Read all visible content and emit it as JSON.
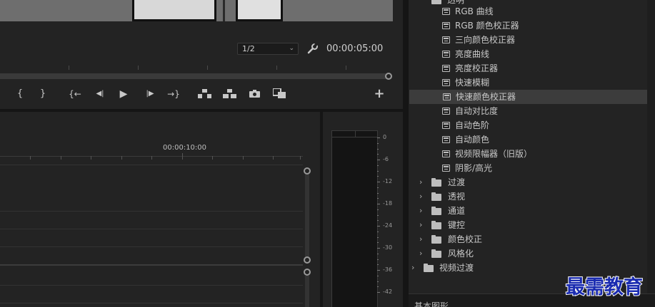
{
  "monitor": {
    "resolution": "1/2",
    "resolution_arrow": "⌄",
    "timecode": "00:00:05:00",
    "transport": {
      "mark_in": "{",
      "mark_out": "}",
      "go_in": "{←",
      "step_back": "◀|",
      "play": "▶",
      "step_forward": "|▶",
      "go_out": "→}",
      "lift": "⏏",
      "extract": "⏏",
      "export_frame": "📷",
      "compare": "⧉",
      "add": "+"
    }
  },
  "timeline": {
    "timecode": "00:00:10:00"
  },
  "meter": {
    "scale": [
      "0",
      "-6",
      "-12",
      "-18",
      "-24",
      "-30",
      "-36",
      "-42"
    ]
  },
  "effects": {
    "parent_folder": "透明",
    "items": [
      "RGB 曲线",
      "RGB 颜色校正器",
      "三向颜色校正器",
      "亮度曲线",
      "亮度校正器",
      "快速模糊",
      "快速颜色校正器",
      "自动对比度",
      "自动色阶",
      "自动颜色",
      "视频限幅器（旧版）",
      "阴影/高光"
    ],
    "selected_index": 6,
    "folders": [
      "过渡",
      "透视",
      "通道",
      "键控",
      "颜色校正",
      "风格化"
    ],
    "top_folder": "视频过渡",
    "bottom_panel": "基本图形"
  },
  "watermark": "最需教育"
}
